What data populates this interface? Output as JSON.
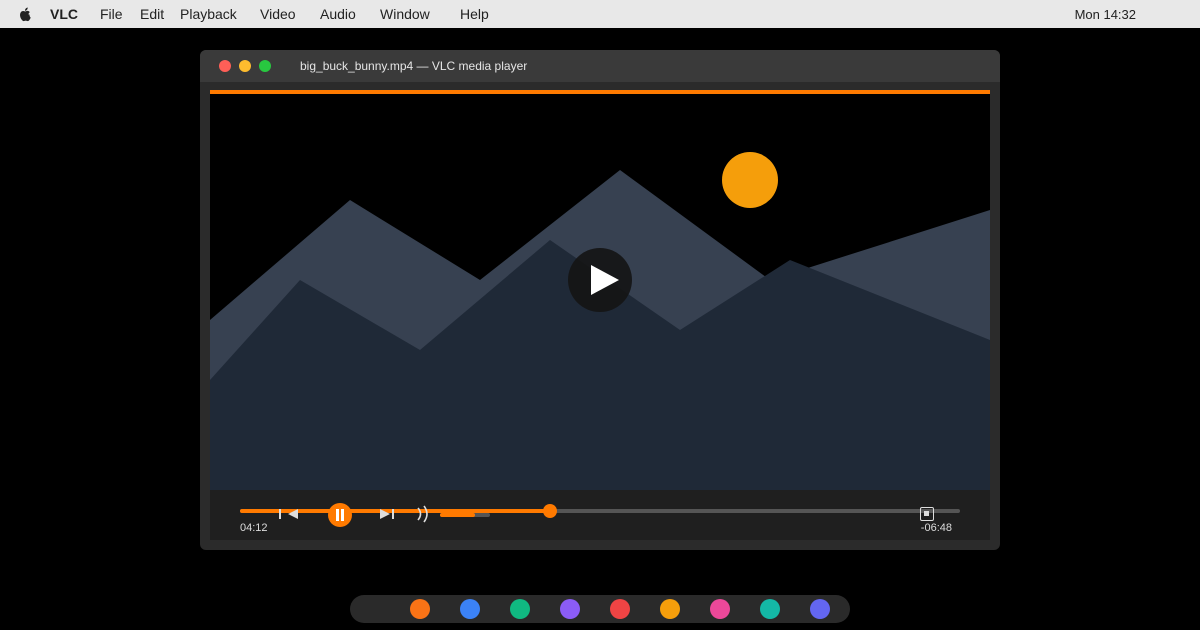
{
  "menubar": {
    "app_name": "VLC",
    "items": [
      "File",
      "Edit",
      "Playback",
      "Video",
      "Audio",
      "Window",
      "Help"
    ],
    "clock": "Mon 14:32",
    "icon": "apple-icon"
  },
  "window": {
    "title": "big_buck_bunny.mp4 — VLC media player",
    "traffic_lights": [
      "close",
      "minimize",
      "maximize"
    ]
  },
  "player": {
    "elapsed": "04:12",
    "remaining": "-06:48",
    "progress_fraction": 0.43,
    "volume_fraction": 0.7,
    "state": "paused",
    "accent_color": "#ff7a00"
  },
  "dock": {
    "apps": [
      {
        "icon": "app-icon-orange",
        "color": "#f97316"
      },
      {
        "icon": "app-icon-blue",
        "color": "#3b82f6"
      },
      {
        "icon": "app-icon-green",
        "color": "#10b981"
      },
      {
        "icon": "app-icon-purple",
        "color": "#8b5cf6"
      },
      {
        "icon": "app-icon-red",
        "color": "#ef4444"
      },
      {
        "icon": "app-icon-amber",
        "color": "#f59e0b"
      },
      {
        "icon": "app-icon-pink",
        "color": "#ec4899"
      },
      {
        "icon": "app-icon-teal",
        "color": "#14b8a6"
      },
      {
        "icon": "app-icon-indigo",
        "color": "#6366f1"
      }
    ]
  }
}
